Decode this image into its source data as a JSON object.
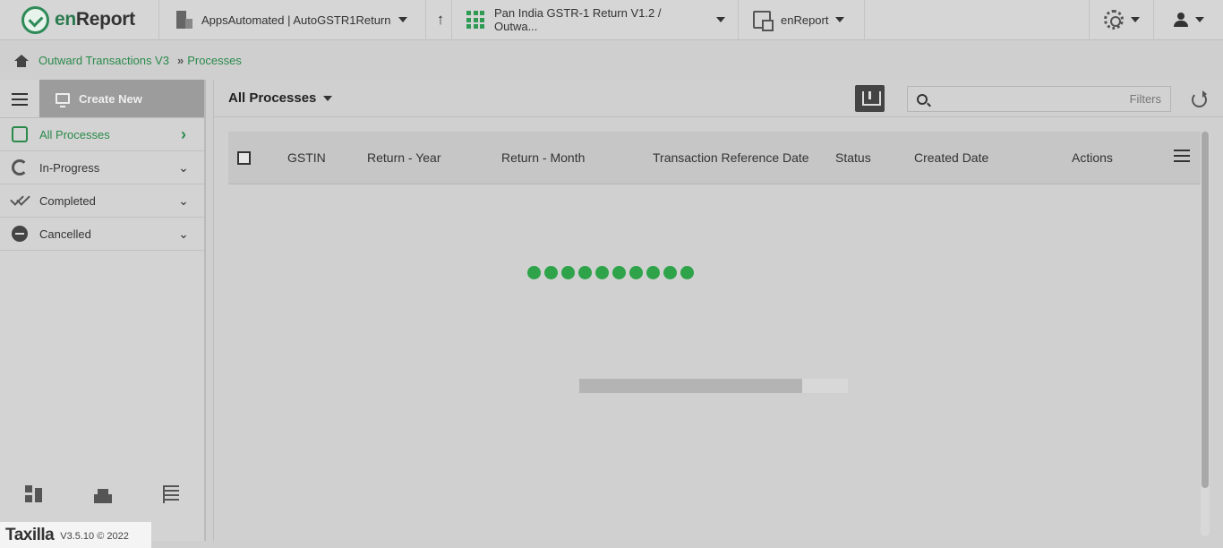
{
  "topbar": {
    "logo_prefix": "en",
    "logo_suffix": "Report",
    "organization": "AppsAutomated | AutoGSTR1Return",
    "application": "Pan India GSTR-1 Return V1.2 / Outwa...",
    "module": "enReport"
  },
  "breadcrumb": {
    "items": [
      "Outward Transactions V3",
      "Processes"
    ],
    "separator": "»"
  },
  "sidebar": {
    "create_new_label": "Create New",
    "items": [
      {
        "label": "All Processes",
        "active": true,
        "chevron": "›"
      },
      {
        "label": "In-Progress",
        "active": false,
        "chevron": "⌄"
      },
      {
        "label": "Completed",
        "active": false,
        "chevron": "⌄"
      },
      {
        "label": "Cancelled",
        "active": false,
        "chevron": "⌄"
      }
    ]
  },
  "main": {
    "view_title": "All Processes",
    "search": {
      "value": "",
      "placeholder": ""
    },
    "filters_label": "Filters",
    "columns": [
      "GSTIN",
      "Return - Year",
      "Return - Month",
      "Transaction Reference Date",
      "Status",
      "Created Date",
      "Actions"
    ],
    "loading_progress": 0.83
  },
  "footer": {
    "brand": "Taxilla",
    "version": "V3.5.10 © 2022"
  },
  "colors": {
    "accent": "#2a8a4a",
    "loader": "#2ea34a",
    "create_new_bg": "#9c9c9c"
  },
  "icons": [
    "home-icon",
    "building-icon",
    "up-arrow-icon",
    "apps-grid-icon",
    "swap-icon",
    "gear-icon",
    "user-icon",
    "hamburger-icon",
    "monitor-icon",
    "download-icon",
    "search-icon",
    "refresh-icon",
    "column-menu-icon",
    "dashboard-icon",
    "city-icon",
    "list-icon"
  ]
}
